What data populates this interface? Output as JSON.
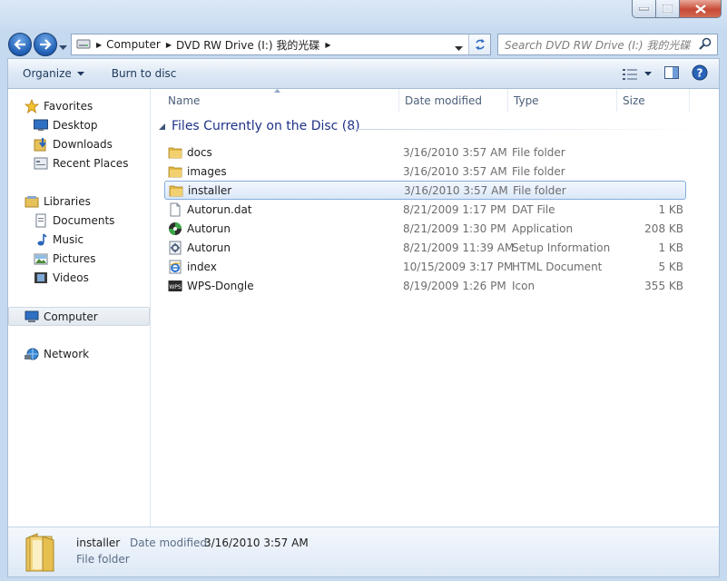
{
  "address": {
    "crumbs": [
      "Computer",
      "DVD RW Drive (I:) 我的光碟"
    ]
  },
  "search": {
    "placeholder": "Search DVD RW Drive (I:) 我的光碟"
  },
  "toolbar": {
    "organize_label": "Organize",
    "burn_label": "Burn to disc"
  },
  "nav": {
    "favorites": {
      "label": "Favorites",
      "items": [
        "Desktop",
        "Downloads",
        "Recent Places"
      ]
    },
    "libraries": {
      "label": "Libraries",
      "items": [
        "Documents",
        "Music",
        "Pictures",
        "Videos"
      ]
    },
    "computer": {
      "label": "Computer"
    },
    "network": {
      "label": "Network"
    }
  },
  "columns": {
    "name": "Name",
    "date": "Date modified",
    "type": "Type",
    "size": "Size"
  },
  "group": {
    "title": "Files Currently on the Disc (8)"
  },
  "files": [
    {
      "name": "docs",
      "date": "3/16/2010 3:57 AM",
      "type": "File folder",
      "size": "",
      "icon": "folder-icon"
    },
    {
      "name": "images",
      "date": "3/16/2010 3:57 AM",
      "type": "File folder",
      "size": "",
      "icon": "folder-icon"
    },
    {
      "name": "installer",
      "date": "3/16/2010 3:57 AM",
      "type": "File folder",
      "size": "",
      "icon": "folder-icon"
    },
    {
      "name": "Autorun.dat",
      "date": "8/21/2009 1:17 PM",
      "type": "DAT File",
      "size": "1 KB",
      "icon": "blank-file-icon"
    },
    {
      "name": "Autorun",
      "date": "8/21/2009 1:30 PM",
      "type": "Application",
      "size": "208 KB",
      "icon": "disc-app-icon"
    },
    {
      "name": "Autorun",
      "date": "8/21/2009 11:39 AM",
      "type": "Setup Information",
      "size": "1 KB",
      "icon": "setup-gear-icon"
    },
    {
      "name": "index",
      "date": "10/15/2009 3:17 PM",
      "type": "HTML Document",
      "size": "5 KB",
      "icon": "ie-document-icon"
    },
    {
      "name": "WPS-Dongle",
      "date": "8/19/2009 1:26 PM",
      "type": "Icon",
      "size": "355 KB",
      "icon": "wps-icon"
    }
  ],
  "details": {
    "name": "installer",
    "date_label": "Date modified:",
    "date_value": "3/16/2010 3:57 AM",
    "type": "File folder"
  },
  "colors": {
    "group_title": "#1e3287",
    "selection_border": "#84acdd",
    "accent_blue": "#1f5fb5"
  }
}
